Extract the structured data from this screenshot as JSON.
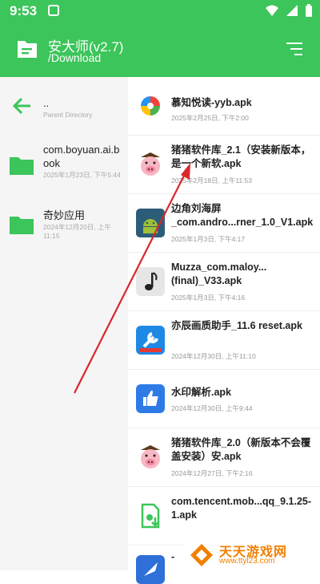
{
  "status_bar": {
    "time": "9:53"
  },
  "app_bar": {
    "title": "安大师(v2.7)",
    "path": "/Download"
  },
  "parent_dir": {
    "name": "..",
    "label": "Parent Directory"
  },
  "directories": [
    {
      "name": "com.boyuan.ai.book",
      "meta": "2025年1月23日, 下午5:44"
    },
    {
      "name": "奇妙应用",
      "meta": "2024年12月20日, 上午11:15"
    }
  ],
  "files": [
    {
      "name": "慕知悦读-yyb.apk",
      "meta": "2025年2月25日, 下午2:00",
      "icon": "colorful-s-icon"
    },
    {
      "name": "猪猪软件库_2.1（安装新版本，是一个新软.apk",
      "meta": "2025年2月18日, 上午11:53",
      "icon": "pig-icon"
    },
    {
      "name": "边角刘海屏_com.andro...rner_1.0_V1.apk",
      "meta": "2025年1月3日, 下午4:17",
      "icon": "android-icon"
    },
    {
      "name": "Muzza_com.maloy...(final)_V33.apk",
      "meta": "2025年1月3日, 下午4:16",
      "icon": "music-note-icon"
    },
    {
      "name": "亦辰画质助手_11.6 reset.apk",
      "meta": "2024年12月30日, 上午11:10",
      "icon": "wrench-icon"
    },
    {
      "name": "水印解析.apk",
      "meta": "2024年12月30日, 上午9:44",
      "icon": "thumbs-up-icon"
    },
    {
      "name": "猪猪软件库_2.0（新版本不会覆盖安装）安.apk",
      "meta": "2024年12月27日, 下午2:16",
      "icon": "pig-icon"
    },
    {
      "name": "com.tencent.mob...qq_9.1.25-1.apk",
      "meta": "",
      "icon": "apk-file-icon"
    },
    {
      "name": "-",
      "meta": "",
      "icon": "rocket-icon"
    }
  ],
  "watermark": {
    "text": "天天游戏网",
    "url": "www.ttyl23.com"
  },
  "colors": {
    "accent": "#3cc55a",
    "annotation": "#d9262b"
  }
}
